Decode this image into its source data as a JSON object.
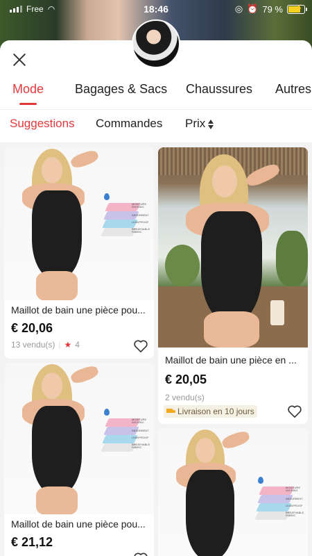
{
  "status_bar": {
    "carrier": "Free",
    "time": "18:46",
    "battery_percent": "79 %",
    "battery_level": 0.79
  },
  "tabs": [
    {
      "label": "Mode",
      "active": true
    },
    {
      "label": "Bagages & Sacs",
      "active": false
    },
    {
      "label": "Chaussures",
      "active": false
    },
    {
      "label": "Autres",
      "active": false
    }
  ],
  "sort": {
    "suggestions": "Suggestions",
    "orders": "Commandes",
    "price": "Prix"
  },
  "products": [
    {
      "title": "Maillot de bain une pièce pou...",
      "price": "€ 20,06",
      "sold": "13 vendu(s)",
      "rating": "4"
    },
    {
      "title": "Maillot de bain une pièce en ...",
      "price": "€ 20,05",
      "sold": "2 vendu(s)",
      "delivery": "Livraison en 10 jours"
    },
    {
      "title": "Maillot de bain une pièce pou...",
      "price": "€ 21,12"
    }
  ],
  "fabric_labels": [
    "MOISTURE WICKING",
    "ABSORBENT",
    "LEAKPROOF",
    "BREATHABLE FABRIC"
  ],
  "colors": {
    "accent": "#e4393c",
    "swimsuit": "#1e1e1e"
  }
}
